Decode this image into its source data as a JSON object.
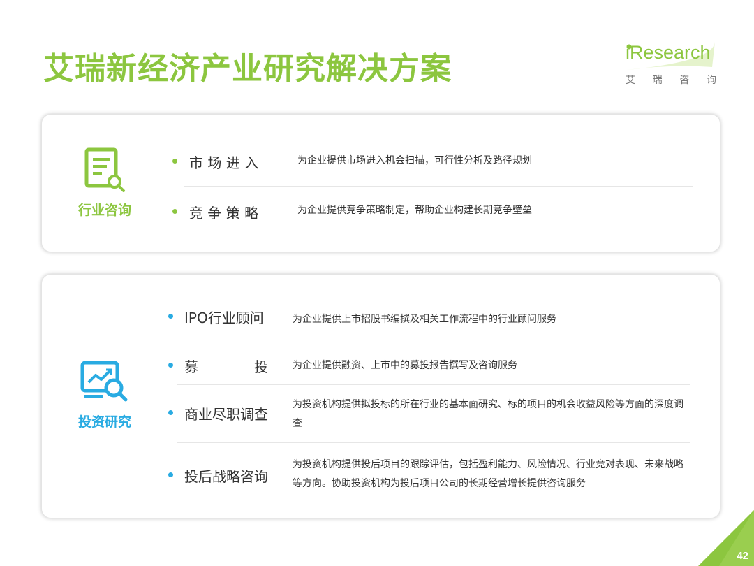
{
  "title": "艾瑞新经济产业研究解决方案",
  "logo": {
    "brand": "iResearch",
    "sub_chars": [
      "艾",
      "瑞",
      "咨",
      "询"
    ]
  },
  "colors": {
    "green": "#8cc63f",
    "blue": "#29abe2"
  },
  "sections": [
    {
      "category": "行业咨询",
      "icon": "document-search-icon",
      "items": [
        {
          "name": "市 场 进 入",
          "desc": "为企业提供市场进入机会扫描，可行性分析及路径规划"
        },
        {
          "name": "竞 争 策 略",
          "desc": "为企业提供竞争策略制定，帮助企业构建长期竞争壁垒"
        }
      ]
    },
    {
      "category": "投资研究",
      "icon": "chart-search-icon",
      "items": [
        {
          "name": "IPO行业顾问",
          "desc": "为企业提供上市招股书编撰及相关工作流程中的行业顾问服务"
        },
        {
          "name_left": "募",
          "name_right": "投",
          "desc": "为企业提供融资、上市中的募投报告撰写及咨询服务"
        },
        {
          "name": "商业尽职调查",
          "desc": "为投资机构提供拟投标的所在行业的基本面研究、标的项目的机会收益风险等方面的深度调查"
        },
        {
          "name": "投后战略咨询",
          "desc": "为投资机构提供投后项目的跟踪评估，包括盈利能力、风险情况、行业竞对表现、未来战略等方向。协助投资机构为投后项目公司的长期经营增长提供咨询服务"
        }
      ]
    }
  ],
  "page_number": "42"
}
